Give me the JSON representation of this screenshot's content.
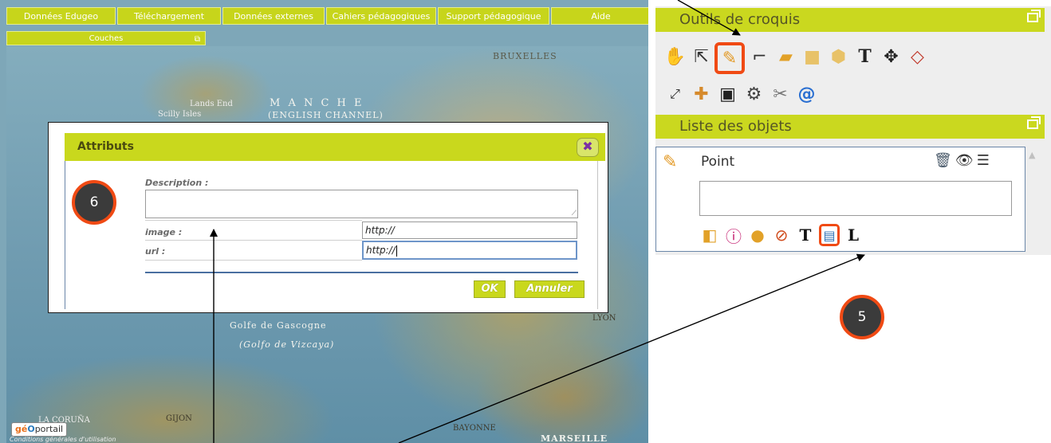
{
  "top_tabs": [
    {
      "label": "Données Edugeo",
      "w": 137
    },
    {
      "label": "Téléchargement",
      "w": 130
    },
    {
      "label": "Données externes",
      "w": 128
    },
    {
      "label": "Cahiers pédagogiques",
      "w": 138
    },
    {
      "label": "Support pédagogique",
      "w": 140
    },
    {
      "label": "Aide",
      "w": 125
    }
  ],
  "layers_bar": {
    "label": "Couches",
    "restore_glyph": "⧉"
  },
  "map": {
    "labels": {
      "manche": "M A N C H E",
      "channel": "(ENGLISH CHANNEL)",
      "scilly": "Scilly Isles",
      "lands_end": "Lands End",
      "bruxelles": "BRUXELLES",
      "golfe": "Golfe de Gascogne",
      "vizcaya": "(Golfo de Vizcaya)",
      "marseille": "MARSEILLE",
      "lyon": "LYON",
      "bayonne": "BAYONNE",
      "la_coruna": "LA CORUÑA",
      "gijon": "GIJON"
    },
    "geoportail_logo": {
      "g": "gé",
      "o": "O",
      "rest": "portail"
    },
    "conditions": "Conditions générales d'utilisation"
  },
  "dialog": {
    "title": "Attributs",
    "close_glyph": "✖",
    "description_label": "Description :",
    "image_label": "image :",
    "url_label": "url :",
    "image_value": "http://",
    "url_value": "http://",
    "textarea_grip": "⟋",
    "ok_label": "OK",
    "cancel_label": "Annuler"
  },
  "markers": {
    "step6": "6",
    "step5": "5"
  },
  "sketch_tools": {
    "header": "Outils de croquis",
    "row1": [
      "hand-icon",
      "arrow-select-icon",
      "pencil-icon",
      "polyline-icon",
      "polygon-icon",
      "rectangle-icon",
      "circle-icon",
      "text-icon",
      "move-icon",
      "rotate-polygon-icon"
    ],
    "row2": [
      "resize-icon",
      "import-icon",
      "save-disk-icon",
      "settings-gear-icon",
      "tools-icon",
      "at-sign-icon"
    ]
  },
  "objects_list": {
    "header": "Liste des objets",
    "item_label": "Point",
    "item_tools": [
      "style-icon",
      "info-icon",
      "point-style-icon",
      "compass-icon",
      "text-icon",
      "attributes-table-icon",
      "label-icon"
    ],
    "item_actions": [
      "trash-icon",
      "eye-icon",
      "order-icon"
    ]
  },
  "colors": {
    "accent": "#c9d81d",
    "highlight": "#f04a14",
    "marker": "#3b3b3b"
  }
}
